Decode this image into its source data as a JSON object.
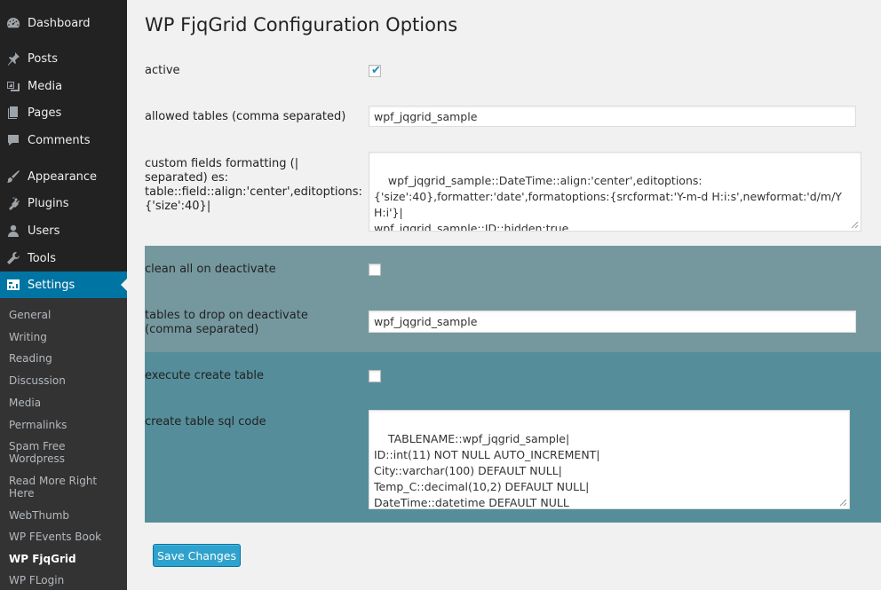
{
  "sidebar": {
    "items": [
      {
        "label": "Dashboard",
        "icon": "dashboard-icon"
      },
      {
        "label": "Posts",
        "icon": "pin-icon"
      },
      {
        "label": "Media",
        "icon": "media-icon"
      },
      {
        "label": "Pages",
        "icon": "pages-icon"
      },
      {
        "label": "Comments",
        "icon": "comment-icon"
      },
      {
        "label": "Appearance",
        "icon": "brush-icon"
      },
      {
        "label": "Plugins",
        "icon": "plugin-icon"
      },
      {
        "label": "Users",
        "icon": "user-icon"
      },
      {
        "label": "Tools",
        "icon": "wrench-icon"
      },
      {
        "label": "Settings",
        "icon": "settings-icon"
      }
    ],
    "submenu": [
      "General",
      "Writing",
      "Reading",
      "Discussion",
      "Media",
      "Permalinks",
      "Spam Free Wordpress",
      "Read More Right Here",
      "WebThumb",
      "WP FEvents Book",
      "WP FjqGrid",
      "WP FLogin"
    ]
  },
  "page": {
    "title": "WP FjqGrid Configuration Options",
    "fields": {
      "active": {
        "label": "active",
        "checked": true
      },
      "allowed_tables": {
        "label": "allowed tables (comma separated)",
        "value": "wpf_jqgrid_sample"
      },
      "custom_fields": {
        "label": "custom fields formatting (| separated) es: table::field::align:'center',editoptions:{'size':40}|",
        "value": "wpf_jqgrid_sample::DateTime::align:'center',editoptions:{'size':40},formatter:'date',formatoptions:{srcformat:'Y-m-d H:i:s',newformat:'d/m/Y H:i'}|\nwpf_jqgrid_sample::ID::hidden:true"
      },
      "clean_all": {
        "label": "clean all on deactivate",
        "checked": false
      },
      "tables_to_drop": {
        "label": "tables to drop on deactivate (comma separated)",
        "value": "wpf_jqgrid_sample"
      },
      "execute_create": {
        "label": "execute create table",
        "checked": false
      },
      "create_sql": {
        "label": "create table sql code",
        "value": "TABLENAME::wpf_jqgrid_sample|\nID::int(11) NOT NULL AUTO_INCREMENT|\nCity::varchar(100) DEFAULT NULL|\nTemp_C::decimal(10,2) DEFAULT NULL|\nDateTime::datetime DEFAULT NULL"
      }
    },
    "save_label": "Save Changes"
  },
  "colors": {
    "sidebar_bg": "#222222",
    "submenu_bg": "#333333",
    "current_menu": "#0074a2",
    "band_light": "#74989e",
    "band_dark": "#558e9a",
    "button": "#2ea2cc"
  }
}
